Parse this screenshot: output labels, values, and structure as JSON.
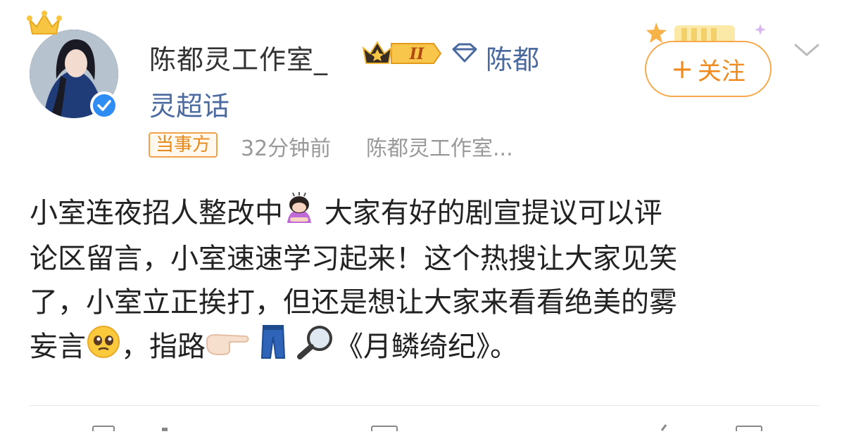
{
  "user": {
    "name": "陈都灵工作室_",
    "vip_level": "II",
    "supertopic_part1": "陈都",
    "supertopic_part2": "灵超话"
  },
  "meta": {
    "badge": "当事方",
    "time": "32分钟前",
    "source": "陈都灵工作室..."
  },
  "follow_button": {
    "label": "关注",
    "plus": "+"
  },
  "post": {
    "line1a": "小室连夜招人整改中",
    "line1b": " 大家有好的剧宣提议可以评",
    "line2": "论区留言，小室速速学习起来！这个热搜让大家见笑",
    "line3": "了，小室立正挨打，但还是想让大家来看看绝美的雾",
    "line4a": "妄言",
    "line4b": "，指路",
    "line4c": "《月鳞绮纪》。"
  },
  "icons": {
    "crown": "crown-icon",
    "verified": "verified-icon",
    "vip": "vip-crown-badge-icon",
    "diamond": "supertopic-diamond-icon",
    "chevron": "chevron-down-icon",
    "person_bowing": "person-bowing-emoji",
    "pleading": "pleading-face-emoji",
    "pointing": "pointing-right-emoji",
    "jeans": "jeans-emoji",
    "magnifier": "magnifying-glass-emoji"
  },
  "colors": {
    "topic_link": "#4a6aa0",
    "follow_orange": "#f08a1e",
    "verified_blue": "#2f8cf2",
    "meta_gray": "#999999"
  }
}
